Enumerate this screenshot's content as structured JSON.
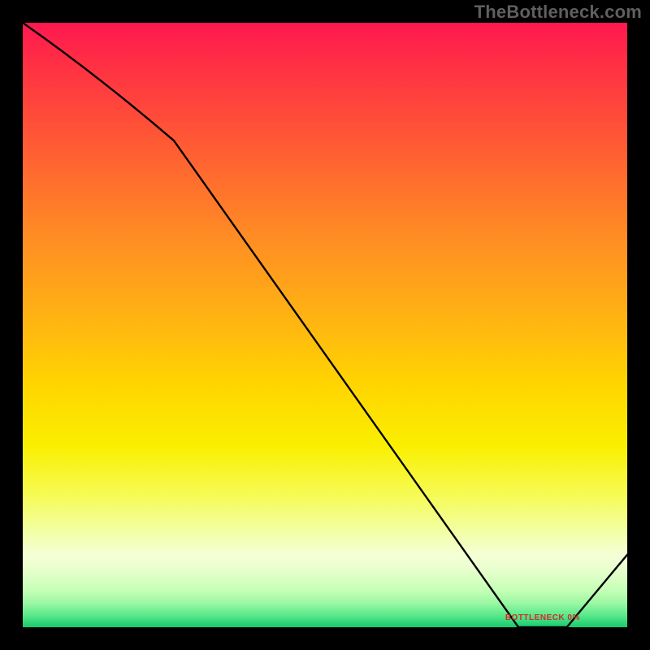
{
  "source_label": "TheBottleneck.com",
  "annotation_label": "BOTTLENECK 0%",
  "chart_data": {
    "type": "line",
    "title": "",
    "xlabel": "",
    "ylabel": "",
    "xlim": [
      0,
      100
    ],
    "ylim": [
      0,
      100
    ],
    "grid": false,
    "legend": false,
    "x": [
      0,
      25,
      82,
      90,
      100
    ],
    "values": [
      100,
      80.5,
      0,
      0,
      12
    ],
    "annotations": [
      {
        "text": "BOTTLENECK 0%",
        "x": 86,
        "y": 1
      }
    ],
    "background_gradient": {
      "direction": "vertical",
      "stops": [
        {
          "pct": 0,
          "color": "#ff1850"
        },
        {
          "pct": 50,
          "color": "#ffd500"
        },
        {
          "pct": 85,
          "color": "#f4ffd6"
        },
        {
          "pct": 100,
          "color": "#18c96e"
        }
      ]
    }
  }
}
